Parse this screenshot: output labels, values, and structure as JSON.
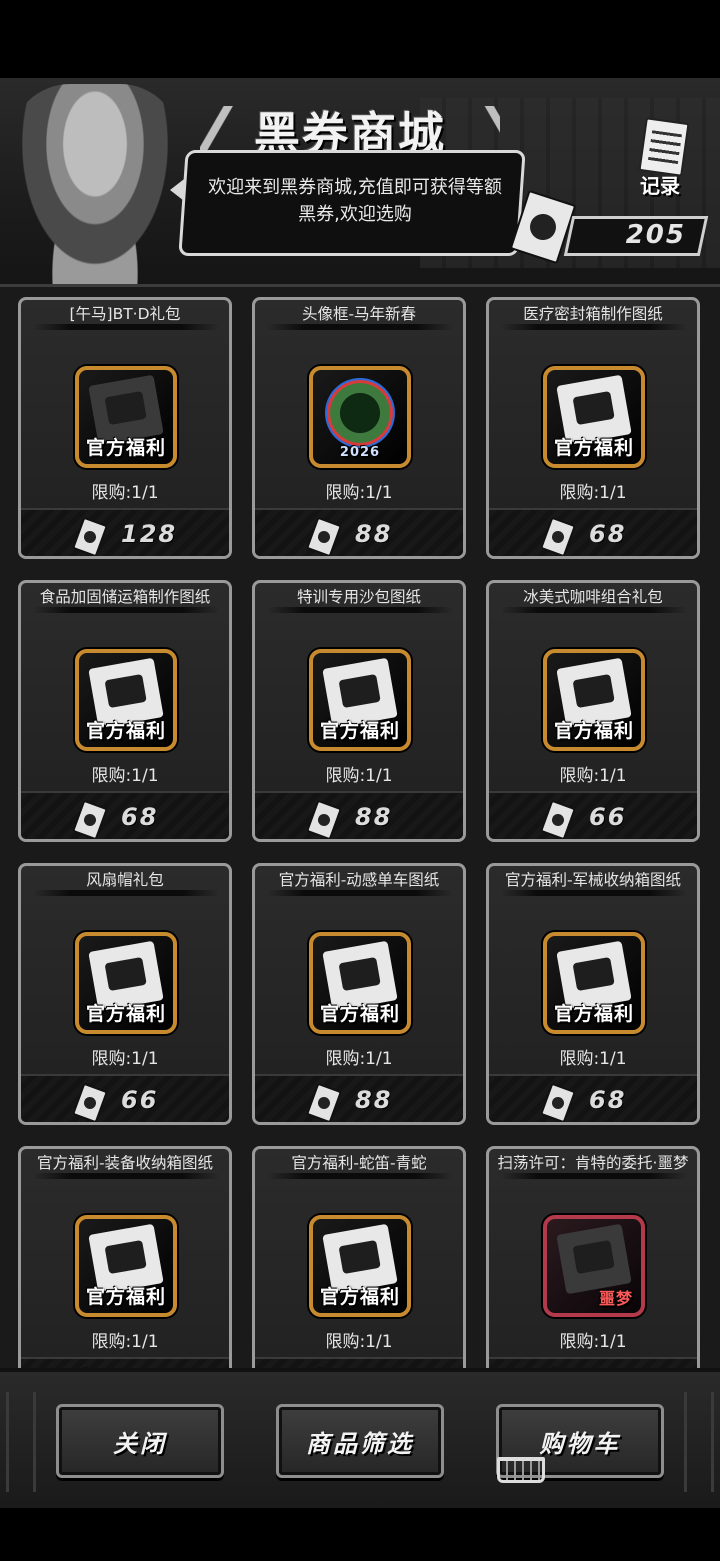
{
  "header": {
    "title": "黑券商城",
    "welcome": "欢迎来到黑券商城,充值即可获得等额黑券,欢迎选购",
    "record_label": "记录",
    "balance": "205"
  },
  "items": [
    {
      "title": "[午马]BT·D礼包",
      "badge": "官方福利",
      "limit": "限购:1/1",
      "price": "128",
      "icon": "lobster-figure-icon"
    },
    {
      "title": "头像框-马年新春",
      "badge": "",
      "limit": "限购:1/1",
      "price": "88",
      "icon": "avatar-frame-2026-icon",
      "frame_year": "2026"
    },
    {
      "title": "医疗密封箱制作图纸",
      "badge": "官方福利",
      "limit": "限购:1/1",
      "price": "68",
      "icon": "medical-box-blueprint-icon"
    },
    {
      "title": "食品加固储运箱制作图纸",
      "badge": "官方福利",
      "limit": "限购:1/1",
      "price": "68",
      "icon": "food-box-blueprint-icon"
    },
    {
      "title": "特训专用沙包图纸",
      "badge": "官方福利",
      "limit": "限购:1/1",
      "price": "88",
      "icon": "sandbag-blueprint-icon"
    },
    {
      "title": "冰美式咖啡组合礼包",
      "badge": "官方福利",
      "limit": "限购:1/1",
      "price": "66",
      "icon": "coffee-gift-icon"
    },
    {
      "title": "风扇帽礼包",
      "badge": "官方福利",
      "limit": "限购:1/1",
      "price": "66",
      "icon": "fan-hat-icon"
    },
    {
      "title": "官方福利-动感单车图纸",
      "badge": "官方福利",
      "limit": "限购:1/1",
      "price": "88",
      "icon": "bike-blueprint-icon"
    },
    {
      "title": "官方福利-军械收纳箱图纸",
      "badge": "官方福利",
      "limit": "限购:1/1",
      "price": "68",
      "icon": "weapon-box-blueprint-icon"
    },
    {
      "title": "官方福利-装备收纳箱图纸",
      "badge": "官方福利",
      "limit": "限购:1/1",
      "price": "",
      "icon": "gear-box-blueprint-icon"
    },
    {
      "title": "官方福利-蛇笛-青蛇",
      "badge": "官方福利",
      "limit": "限购:1/1",
      "price": "",
      "icon": "snake-flute-icon"
    },
    {
      "title": "扫荡许可：肯特的委托·噩梦",
      "badge": "噩梦",
      "limit": "限购:1/1",
      "price": "",
      "icon": "sweep-permit-nightmare-icon"
    }
  ],
  "buttons": {
    "close": "关闭",
    "filter": "商品筛选",
    "cart": "购物车"
  }
}
